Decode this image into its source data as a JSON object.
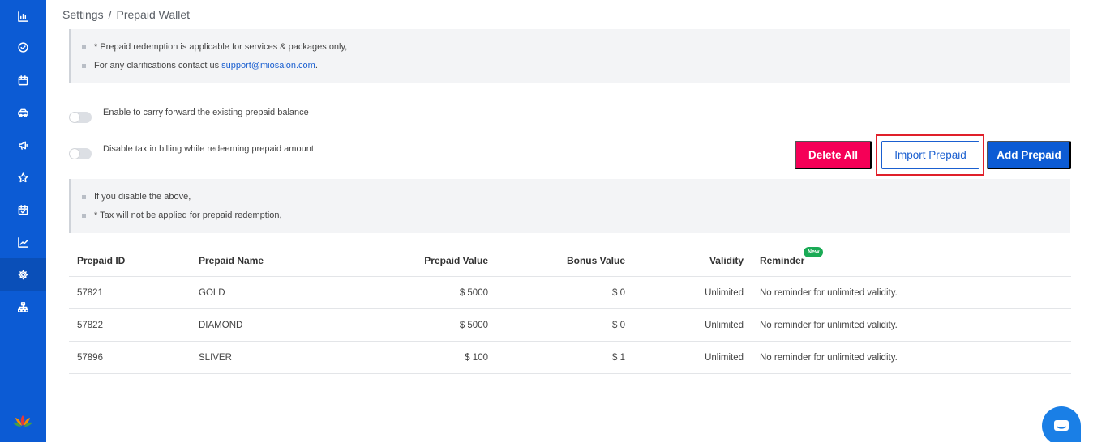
{
  "breadcrumb": {
    "parent": "Settings",
    "separator": "/",
    "current": "Prepaid Wallet"
  },
  "sidebar": {
    "items": [
      {
        "icon": "bar-chart-icon",
        "active": false
      },
      {
        "icon": "check-circle-icon",
        "active": false
      },
      {
        "icon": "calendar-icon",
        "active": false
      },
      {
        "icon": "users-icon",
        "active": false
      },
      {
        "icon": "megaphone-icon",
        "active": false
      },
      {
        "icon": "star-icon",
        "active": false
      },
      {
        "icon": "calendar-check-icon",
        "active": false
      },
      {
        "icon": "line-chart-icon",
        "active": false
      },
      {
        "icon": "gear-icon",
        "active": true
      },
      {
        "icon": "org-chart-icon",
        "active": false
      }
    ],
    "logo": "lotus-logo"
  },
  "notes": {
    "line1": "* Prepaid redemption is applicable for services & packages only,",
    "line2_prefix": "For any clarifications contact us ",
    "line2_email": "support@miosalon.com",
    "line2_suffix": "."
  },
  "toggles": {
    "carry_forward": {
      "label": "Enable to carry forward the existing prepaid balance",
      "on": false
    },
    "disable_tax": {
      "label": "Disable tax in billing while redeeming prepaid amount",
      "on": false
    }
  },
  "tax_notes": {
    "line1": "If you disable the above,",
    "line2": "* Tax will not be applied for prepaid redemption,"
  },
  "buttons": {
    "delete_all": "Delete All",
    "import_prepaid": "Import Prepaid",
    "add_prepaid": "Add Prepaid"
  },
  "table": {
    "columns": [
      "Prepaid ID",
      "Prepaid Name",
      "Prepaid Value",
      "Bonus Value",
      "Validity",
      "Reminder"
    ],
    "reminder_badge": "New",
    "rows": [
      {
        "id": "57821",
        "name": "GOLD",
        "prepaid_value": "$ 5000",
        "bonus_value": "$ 0",
        "validity": "Unlimited",
        "reminder": "No reminder for unlimited validity."
      },
      {
        "id": "57822",
        "name": "DIAMOND",
        "prepaid_value": "$ 5000",
        "bonus_value": "$ 0",
        "validity": "Unlimited",
        "reminder": "No reminder for unlimited validity."
      },
      {
        "id": "57896",
        "name": "SLIVER",
        "prepaid_value": "$ 100",
        "bonus_value": "$ 1",
        "validity": "Unlimited",
        "reminder": "No reminder for unlimited validity."
      }
    ]
  },
  "colors": {
    "sidebar": "#0c5bd4",
    "primary": "#0c5bd4",
    "danger": "#f50057",
    "highlight": "#e0202a",
    "badge": "#1aaa55"
  },
  "chat_widget": {
    "icon": "chat-icon"
  }
}
